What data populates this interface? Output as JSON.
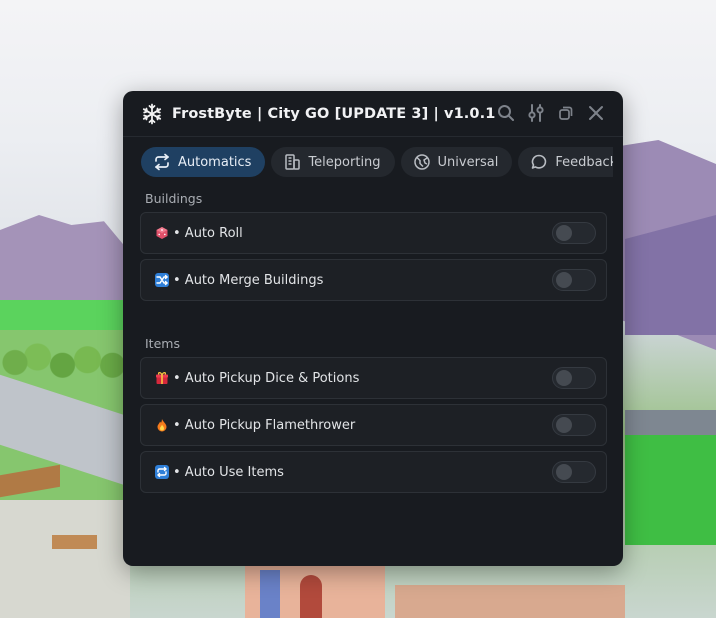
{
  "window": {
    "title": "FrostByte | City GO [UPDATE 3] | v1.0.1",
    "controls": [
      "search-icon",
      "sliders-icon",
      "restore-icon",
      "close-icon"
    ]
  },
  "tabs": [
    {
      "label": "Automatics",
      "icon": "swap-arrows-icon",
      "active": true
    },
    {
      "label": "Teleporting",
      "icon": "building-icon",
      "active": false
    },
    {
      "label": "Universal",
      "icon": "globe-icon",
      "active": false
    },
    {
      "label": "Feedback",
      "icon": "chat-bubble-icon",
      "active": false
    }
  ],
  "sections": [
    {
      "label": "Buildings",
      "items": [
        {
          "emoji": "🎲",
          "label": "• Auto Roll",
          "enabled": false
        },
        {
          "emoji": "🔀",
          "label": "• Auto Merge Buildings",
          "enabled": false
        }
      ]
    },
    {
      "label": "Items",
      "items": [
        {
          "emoji": "🎁",
          "label": "• Auto Pickup Dice & Potions",
          "enabled": false
        },
        {
          "emoji": "🔥",
          "label": "• Auto Pickup Flamethrower",
          "enabled": false
        },
        {
          "emoji": "🔁",
          "label": "• Auto Use Items",
          "enabled": false
        }
      ]
    }
  ],
  "colors": {
    "panel_bg": "#181b20",
    "row_bg": "#1d2025",
    "active_tab": "#1f4062",
    "text": "#e2e4e7"
  }
}
